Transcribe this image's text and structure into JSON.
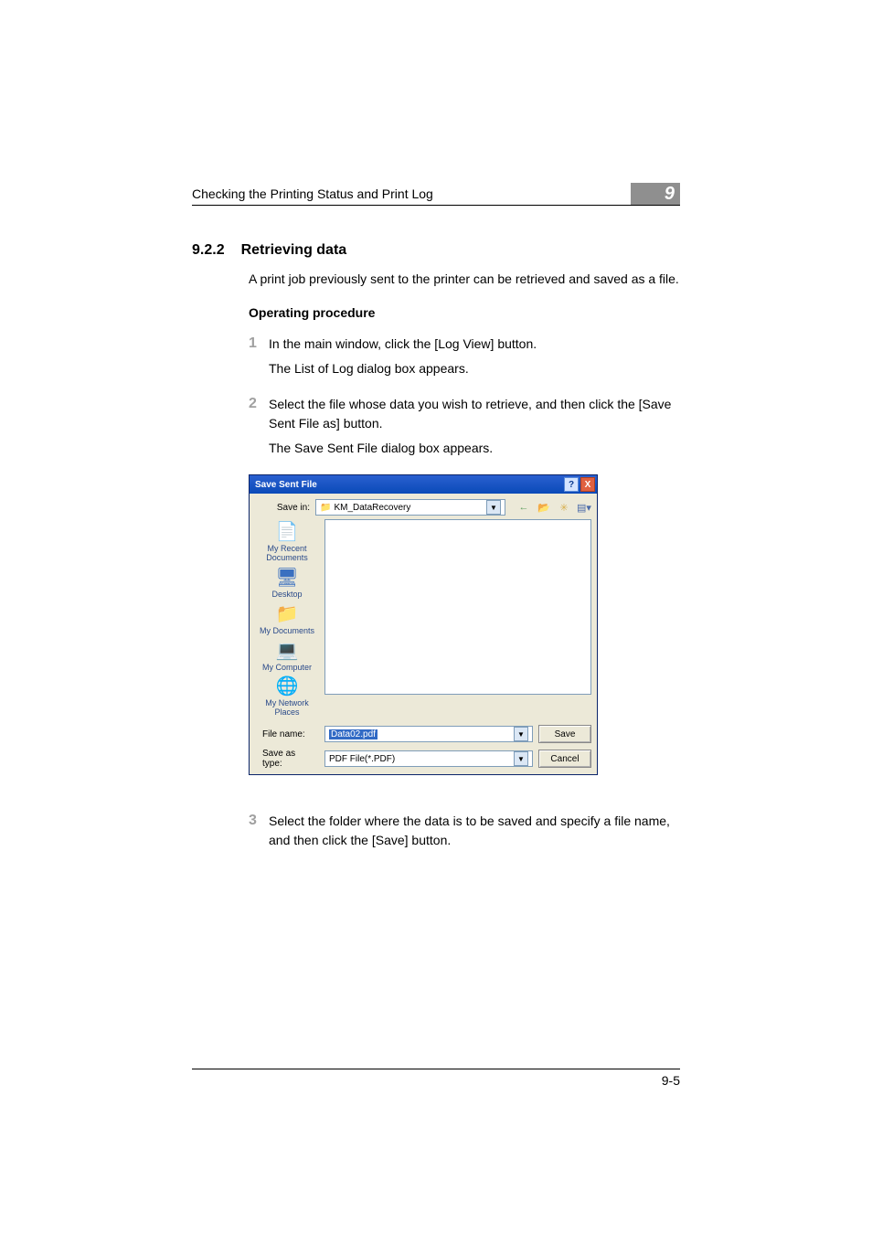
{
  "header": {
    "title": "Checking the Printing Status and Print Log",
    "chapter": "9"
  },
  "section": {
    "number": "9.2.2",
    "title": "Retrieving data",
    "intro": "A print job previously sent to the printer can be retrieved and saved as a file.",
    "procedure_label": "Operating procedure"
  },
  "steps": [
    {
      "num": "1",
      "text": "In the main window, click the [Log View] button.",
      "sub": "The List of Log dialog box appears."
    },
    {
      "num": "2",
      "text": "Select the file whose data you wish to retrieve, and then click the [Save Sent File as] button.",
      "sub": "The Save Sent File dialog box appears."
    },
    {
      "num": "3",
      "text": "Select the folder where the data is to be saved and specify a file name, and then click the [Save] button.",
      "sub": ""
    }
  ],
  "dialog": {
    "title": "Save Sent File",
    "help_glyph": "?",
    "close_glyph": "X",
    "save_in_label": "Save in:",
    "folder_name": "KM_DataRecovery",
    "places": [
      {
        "label": "My Recent Documents"
      },
      {
        "label": "Desktop"
      },
      {
        "label": "My Documents"
      },
      {
        "label": "My Computer"
      },
      {
        "label": "My Network Places"
      }
    ],
    "filename_label": "File name:",
    "filename_value": "Data02.pdf",
    "type_label": "Save as type:",
    "type_value": "PDF File(*.PDF)",
    "save_btn": "Save",
    "cancel_btn": "Cancel"
  },
  "footer": {
    "page": "9-5"
  }
}
